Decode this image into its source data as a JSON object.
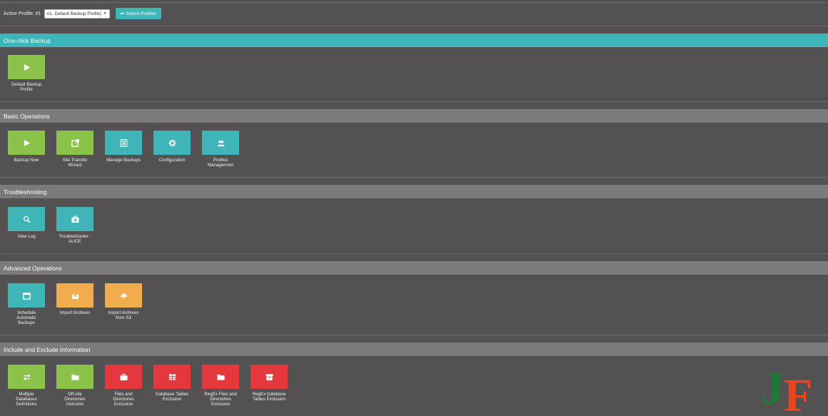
{
  "profile": {
    "label": "Active Profile: #1",
    "selected": "#1. Default Backup Profile",
    "switch_label": "Switch Profiles"
  },
  "sections": {
    "one_click": {
      "title": "One-click Backup",
      "tiles": [
        {
          "label": "Default Backup\nProfile",
          "icon": "play-icon",
          "color": "#8bc34a"
        }
      ]
    },
    "basic": {
      "title": "Basic Operations",
      "tiles": [
        {
          "label": "Backup Now",
          "icon": "play-icon",
          "color": "#8bc34a"
        },
        {
          "label": "Site Transfer\nWizard",
          "icon": "external-link-icon",
          "color": "#8bc34a"
        },
        {
          "label": "Manage Backups",
          "icon": "list-icon",
          "color": "#40b5b9"
        },
        {
          "label": "Configuration",
          "icon": "gear-icon",
          "color": "#40b5b9"
        },
        {
          "label": "Profiles\nManagement",
          "icon": "users-icon",
          "color": "#40b5b9"
        }
      ]
    },
    "troubleshooting": {
      "title": "Troubleshooting",
      "tiles": [
        {
          "label": "View Log",
          "icon": "search-icon",
          "color": "#40b5b9"
        },
        {
          "label": "Troubleshooter -\nALICE",
          "icon": "first-aid-kit-icon",
          "color": "#40b5b9"
        }
      ]
    },
    "advanced": {
      "title": "Advanced Operations",
      "tiles": [
        {
          "label": "Schedule\nAutomatic\nBackups",
          "icon": "calendar-icon",
          "color": "#40b5b9"
        },
        {
          "label": "Import Archives",
          "icon": "import-box-icon",
          "color": "#f0ac4d"
        },
        {
          "label": "Import Archives\nfrom S3",
          "icon": "cloud-upload-icon",
          "color": "#f0ac4d"
        }
      ]
    },
    "include_exclude": {
      "title": "Include and Exclude Information",
      "tiles": [
        {
          "label": "Multiple\nDatabases\nDefinitions",
          "icon": "arrows-exchange-icon",
          "color": "#8bc34a"
        },
        {
          "label": "Off-site\nDirectories\nInclusion",
          "icon": "folder-icon",
          "color": "#8bc34a"
        },
        {
          "label": "Files and\nDirectories\nExclusion",
          "icon": "briefcase-icon",
          "color": "#e4383d"
        },
        {
          "label": "Database Tables\nExclusion",
          "icon": "table-icon",
          "color": "#e4383d"
        },
        {
          "label": "RegEx Files and\nDirectories\nExclusion",
          "icon": "folder-icon",
          "color": "#e4383d"
        },
        {
          "label": "RegEx Database\nTables Exclusion",
          "icon": "archive-icon",
          "color": "#e4383d"
        }
      ]
    }
  },
  "logo": {
    "text": "JF",
    "colors": [
      "#1f7a3a",
      "#e8451e"
    ]
  }
}
